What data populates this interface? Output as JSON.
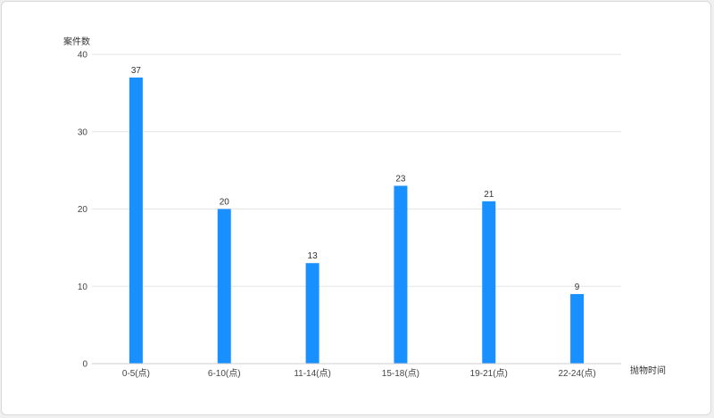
{
  "chart_data": {
    "type": "bar",
    "categories": [
      "0-5(点)",
      "6-10(点)",
      "11-14(点)",
      "15-18(点)",
      "19-21(点)",
      "22-24(点)"
    ],
    "values": [
      37,
      20,
      13,
      23,
      21,
      9
    ],
    "xlabel": "抛物时间",
    "ylabel": "案件数",
    "ylim": [
      0,
      40
    ],
    "yticks": [
      0,
      10,
      20,
      30,
      40
    ],
    "grid": true,
    "bar_color": "#1890ff",
    "data_labels": true
  }
}
